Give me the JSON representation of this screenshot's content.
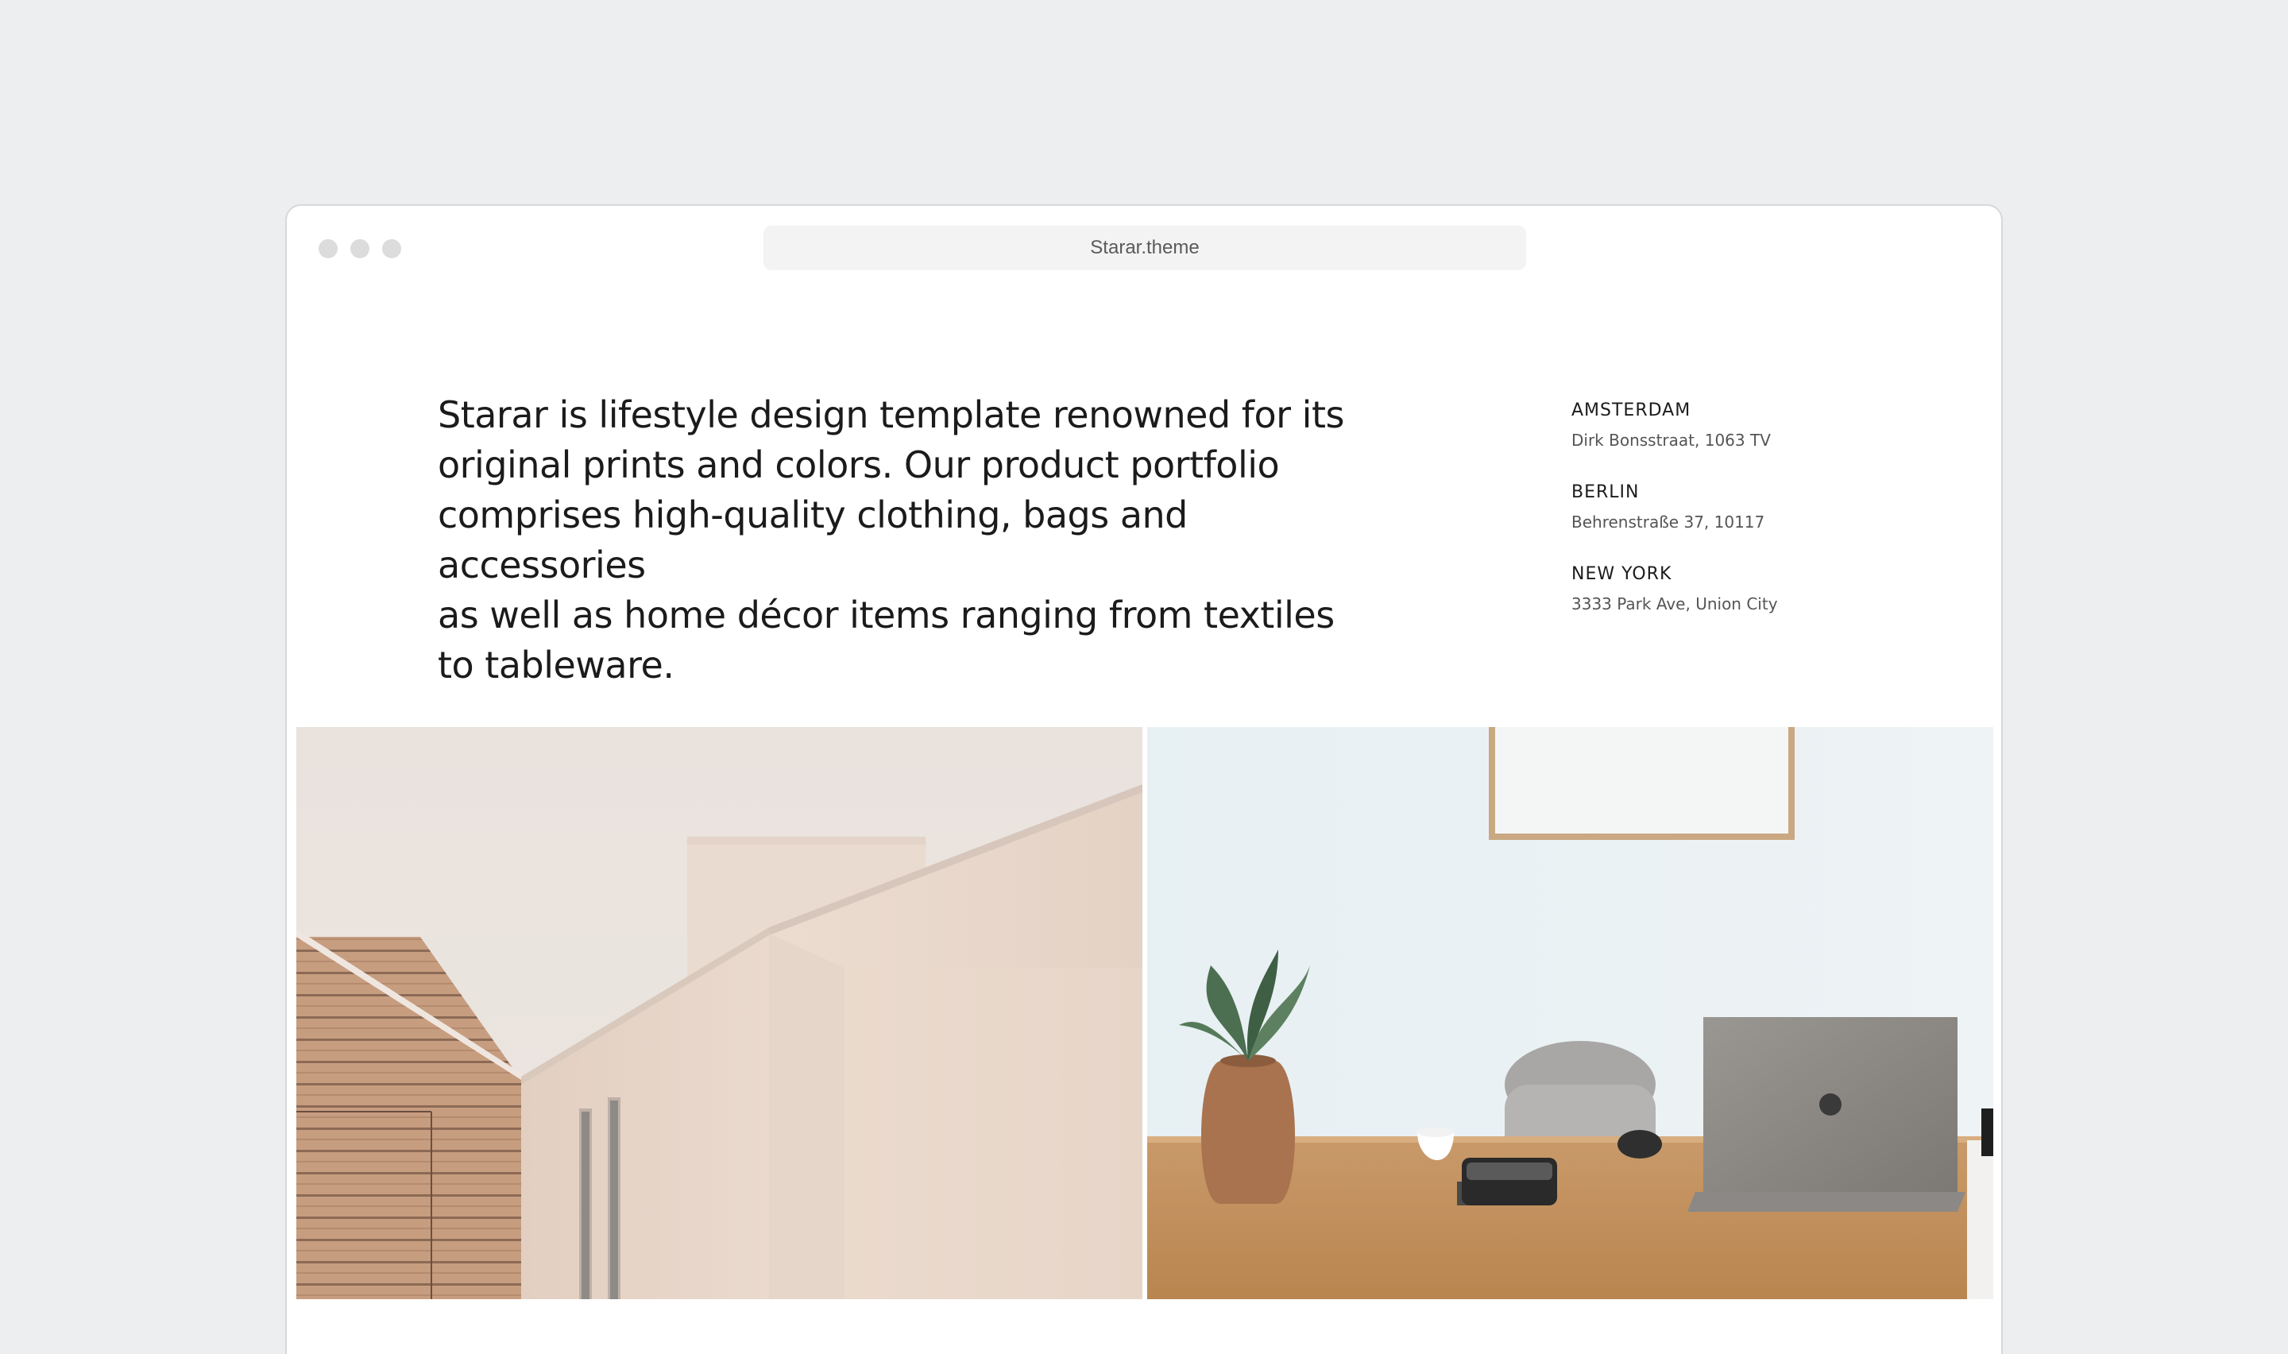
{
  "browser": {
    "url": "Starar.theme"
  },
  "intro": {
    "lines": [
      "Starar is lifestyle design template renowned for its",
      "original prints and colors. Our product portfolio",
      "comprises high-quality clothing, bags and accessories",
      "as well as home décor items ranging from textiles",
      "to tableware."
    ]
  },
  "locations": [
    {
      "city": "AMSTERDAM",
      "address": "Dirk Bonsstraat, 1063 TV"
    },
    {
      "city": "BERLIN",
      "address": "Behrenstraße 37, 10117"
    },
    {
      "city": "NEW YORK",
      "address": "3333 Park Ave, Union City"
    }
  ],
  "gallery": {
    "images": [
      {
        "icon": "architecture-photo"
      },
      {
        "icon": "desk-workspace-photo"
      }
    ]
  }
}
